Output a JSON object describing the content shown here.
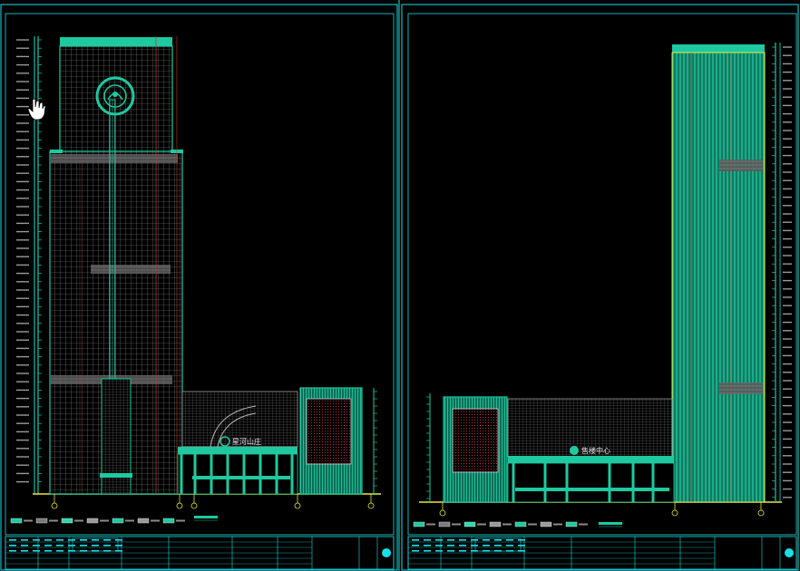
{
  "colors": {
    "background": "#000000",
    "frame": "#19e0e6",
    "teal": "#1ec9a0",
    "tealDark": "#0f8a6a",
    "grid": "#9a9a9a",
    "red": "#c0392b",
    "yellow": "#e8e83a",
    "white": "#e6e6e6"
  },
  "sheets": [
    {
      "id": "left",
      "signage_text": "星河山庄"
    },
    {
      "id": "right",
      "signage_text": "售楼中心"
    }
  ],
  "cursor_icon": "hand-pointer-icon"
}
